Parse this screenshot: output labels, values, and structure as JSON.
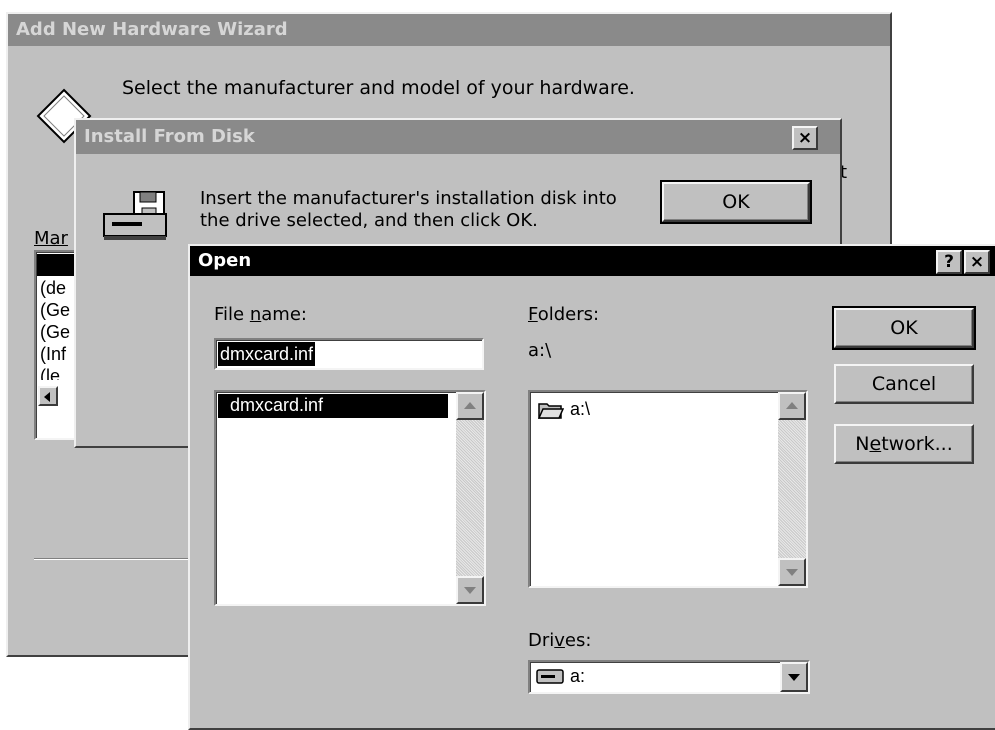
{
  "wizard": {
    "title": "Add New Hardware Wizard",
    "instruction": "Select the manufacturer and model of your hardware.",
    "manufacturers_label_visible": "Mar",
    "manufacturer_items": [
      "",
      "(de",
      "(Ge",
      "(Ge",
      "(Inf",
      "(le"
    ],
    "trailing_char": "t"
  },
  "install_disk": {
    "title": "Install From Disk",
    "message_line1": "Insert the manufacturer's installation disk into",
    "message_line2": "the drive selected, and then click OK.",
    "ok_label": "OK",
    "close_glyph": "×"
  },
  "open_dialog": {
    "title": "Open",
    "help_glyph": "?",
    "close_glyph": "×",
    "file_name_label": {
      "pre": "File ",
      "accel": "n",
      "post": "ame:"
    },
    "file_name_value": "dmxcard.inf",
    "files": [
      "dmxcard.inf"
    ],
    "folders_label": {
      "pre": "",
      "accel": "F",
      "post": "olders:"
    },
    "current_folder": "a:\\",
    "folder_items": [
      "a:\\"
    ],
    "drives_label": {
      "pre": "Dri",
      "accel": "v",
      "post": "es:"
    },
    "drive_selected": "a:",
    "ok_label": "OK",
    "cancel_label": "Cancel",
    "network_label": {
      "pre": "N",
      "accel": "e",
      "post": "twork..."
    }
  },
  "icons": {
    "wizard": "hardware-diamond-icon",
    "install": "disk-drive-icon",
    "folder": "open-folder-icon",
    "drive": "floppy-drive-icon"
  },
  "colors": {
    "face": "#c0c0c0",
    "inactive_title": "#8a8a8a",
    "active_title": "#000000",
    "selection": "#000000"
  }
}
